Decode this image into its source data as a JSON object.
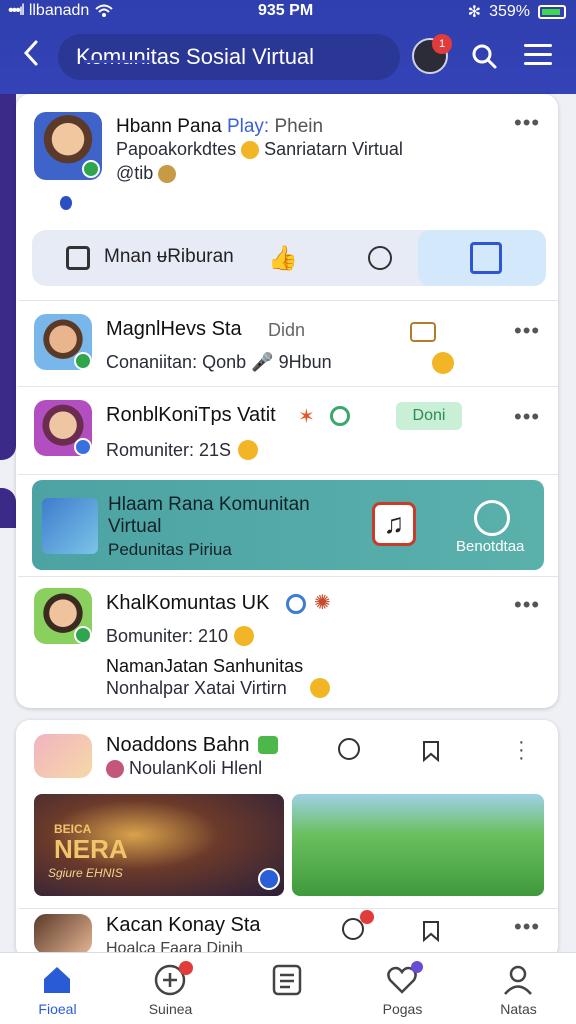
{
  "status": {
    "carrier": "llbanadn",
    "time": "935 PM",
    "battery": "359%"
  },
  "header": {
    "title": "Komunitas Sosial Virtual",
    "badge_count": "1"
  },
  "profile_card": {
    "name_part1": "Hbann Pana",
    "name_part2": "Play:",
    "name_part3": "Phein",
    "subtitle": "Papoakorkdtes",
    "subtitle2": "Sanriatarn Virtual",
    "meta": "@tib"
  },
  "tabs": {
    "label": "Mnan ᵾRiburan"
  },
  "communities": [
    {
      "name": "MagnlHevs Sta",
      "tag": "Didn",
      "sub": "Conaniitan: Qonb",
      "sub2": "9Hbun"
    },
    {
      "name": "RonblKoniTps Vatit",
      "join": "Doni",
      "sub": "Romuniter: 21S"
    }
  ],
  "featured": {
    "name": "Hlaam Rana Komunitan",
    "name2": "Virtual",
    "sub": "Pedunitas Piriua",
    "cta": "Benotdtaa"
  },
  "community3": {
    "name": "KhalKomuntas UK",
    "sub": "Bomuniter: 210",
    "desc1": "NamanJatan Sanhunitas",
    "desc2": "Nonhalpar Xatai Virtirn"
  },
  "post": {
    "author": "Noaddons Bahn",
    "sub": "NoulanKoli Hlenl",
    "image_text": "NERA",
    "image_sub": "Sgiure EHNIS",
    "image_top": "BEICA"
  },
  "post2": {
    "author": "Kacan Konay Sta",
    "sub": "Hoalca Faara Dinih"
  },
  "bottom_nav": {
    "items": [
      {
        "label": "Fioeal"
      },
      {
        "label": "Suinea"
      },
      {
        "label": ""
      },
      {
        "label": "Pogas"
      },
      {
        "label": "Natas"
      }
    ]
  },
  "colors": {
    "header": "#3443b6",
    "accent": "#2a5bd7",
    "featured": "#4da3a3"
  }
}
